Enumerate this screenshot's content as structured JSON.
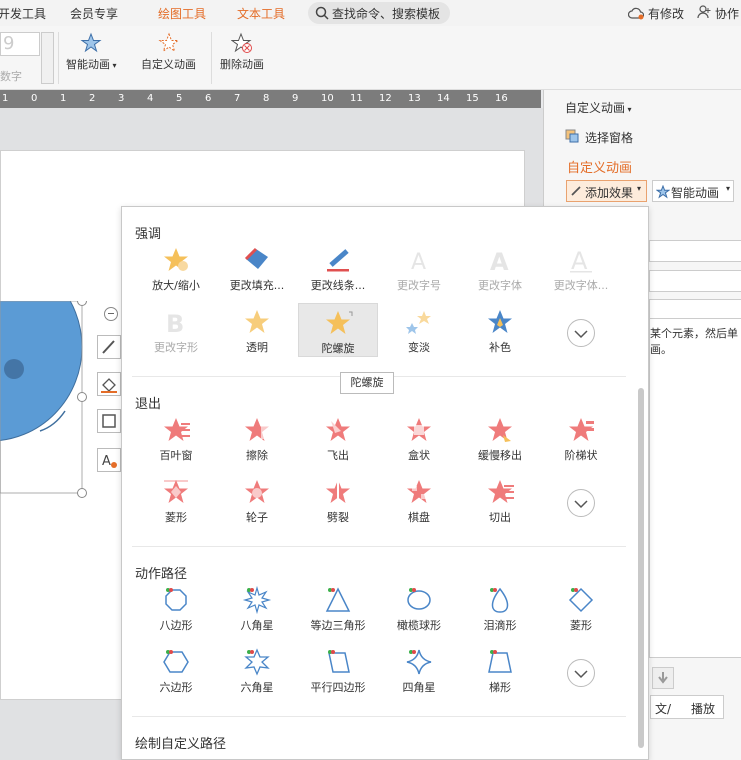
{
  "tabs": {
    "dev": "开发工具",
    "member": "会员专享",
    "draw": "绘图工具",
    "text": "文本工具",
    "search": "查找命令、搜索模板",
    "modified": "有修改",
    "collab": "协作"
  },
  "ribbon": {
    "smart": "智能动画",
    "custom": "自定义动画",
    "delete": "删除动画",
    "number_partial": "数字"
  },
  "ruler_ticks": [
    "1",
    "0",
    "1",
    "2",
    "3",
    "4",
    "5",
    "6",
    "7",
    "8",
    "9",
    "10",
    "11",
    "12",
    "13",
    "14",
    "15",
    "16"
  ],
  "panel": {
    "title_dropdown": "自定义动画",
    "select_pane": "选择窗格",
    "heading": "自定义动画",
    "add_effect": "添加效果",
    "smart": "智能动画",
    "hint_line1": "某个元素，然后单",
    "hint_line2": "画。",
    "play_partial": "播放",
    "play_prefix": "文/"
  },
  "dropdown": {
    "emphasis_title": "强调",
    "emphasis": [
      "放大/缩小",
      "更改填充...",
      "更改线条...",
      "更改字号",
      "更改字体",
      "更改字体...",
      "更改字形",
      "透明",
      "陀螺旋",
      "变淡",
      "补色"
    ],
    "exit_title": "退出",
    "exit": [
      "百叶窗",
      "擦除",
      "飞出",
      "盒状",
      "缓慢移出",
      "阶梯状",
      "菱形",
      "轮子",
      "劈裂",
      "棋盘",
      "切出"
    ],
    "path_title": "动作路径",
    "path": [
      "八边形",
      "八角星",
      "等边三角形",
      "橄榄球形",
      "泪滴形",
      "菱形",
      "六边形",
      "六角星",
      "平行四边形",
      "四角星",
      "梯形"
    ],
    "custom_title": "绘制自定义路径"
  },
  "tooltip": "陀螺旋",
  "colors": {
    "accent": "#e46d28",
    "circle": "#5b9bd5",
    "star": "#f5c05a",
    "exit": "#ef7b7b",
    "path": "#4a86c8"
  }
}
